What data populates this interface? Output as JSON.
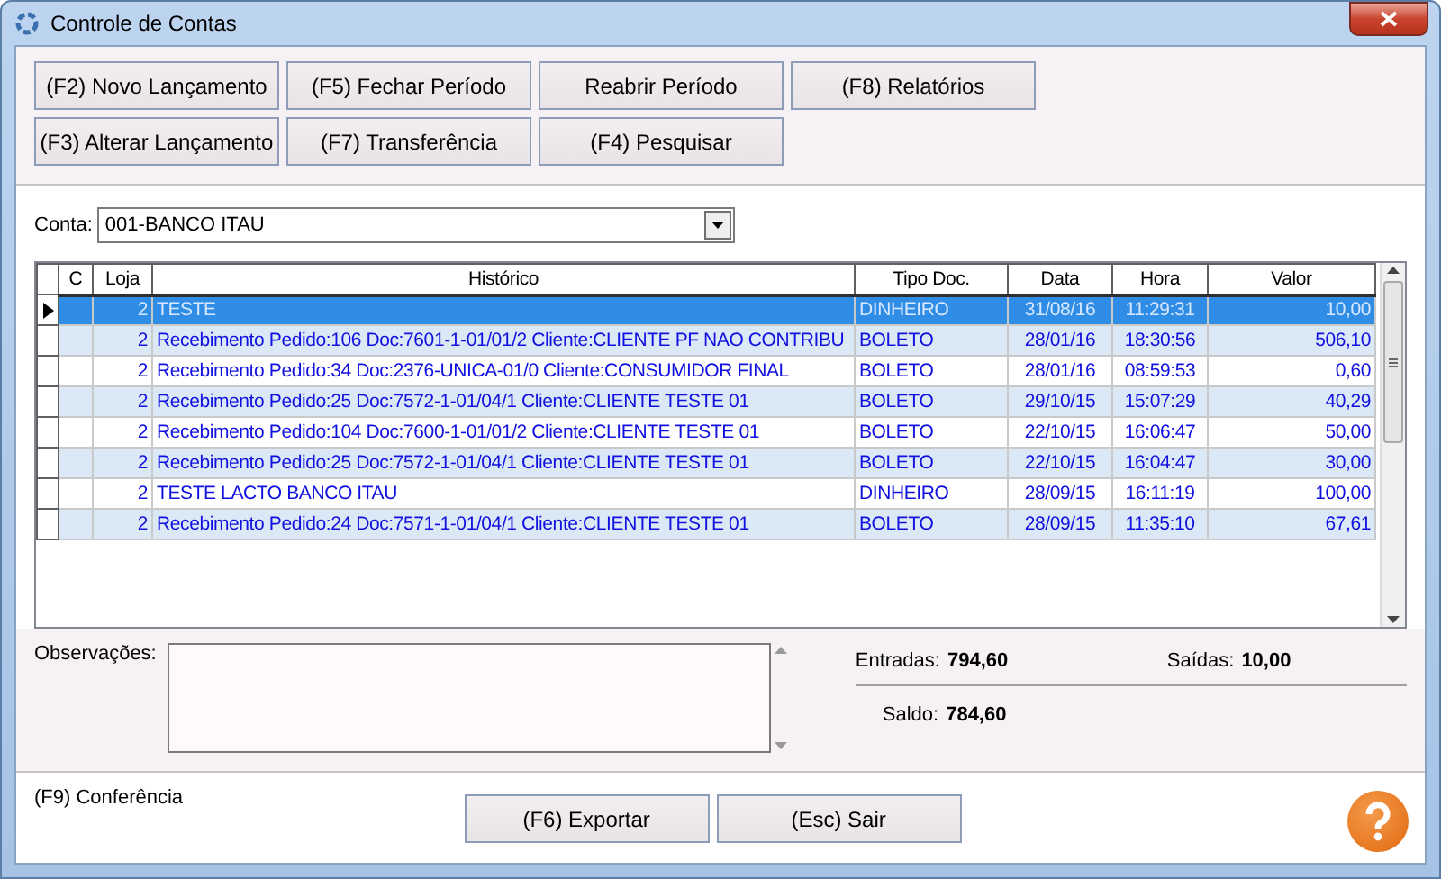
{
  "window": {
    "title": "Controle de Contas"
  },
  "toolbar": [
    [
      "(F2) Novo Lançamento",
      "(F5) Fechar Período",
      "Reabrir Período",
      "(F8) Relatórios"
    ],
    [
      "(F3) Alterar Lançamento",
      "(F7) Transferência",
      "(F4) Pesquisar"
    ]
  ],
  "account": {
    "label": "Conta:",
    "value": "001-BANCO ITAU"
  },
  "table": {
    "columns": [
      "C",
      "Loja",
      "Histórico",
      "Tipo Doc.",
      "Data",
      "Hora",
      "Valor"
    ],
    "rows": [
      {
        "selected": true,
        "cells": [
          "",
          "2",
          "TESTE",
          "DINHEIRO",
          "31/08/16",
          "11:29:31",
          "10,00"
        ]
      },
      {
        "selected": false,
        "cells": [
          "",
          "2",
          "Recebimento Pedido:106 Doc:7601-1-01/01/2 Cliente:CLIENTE PF NAO CONTRIBU",
          "BOLETO",
          "28/01/16",
          "18:30:56",
          "506,10"
        ]
      },
      {
        "selected": false,
        "cells": [
          "",
          "2",
          "Recebimento Pedido:34 Doc:2376-UNICA-01/0 Cliente:CONSUMIDOR FINAL",
          "BOLETO",
          "28/01/16",
          "08:59:53",
          "0,60"
        ]
      },
      {
        "selected": false,
        "cells": [
          "",
          "2",
          "Recebimento Pedido:25 Doc:7572-1-01/04/1 Cliente:CLIENTE TESTE 01",
          "BOLETO",
          "29/10/15",
          "15:07:29",
          "40,29"
        ]
      },
      {
        "selected": false,
        "cells": [
          "",
          "2",
          "Recebimento Pedido:104 Doc:7600-1-01/01/2 Cliente:CLIENTE TESTE 01",
          "BOLETO",
          "22/10/15",
          "16:06:47",
          "50,00"
        ]
      },
      {
        "selected": false,
        "cells": [
          "",
          "2",
          "Recebimento Pedido:25 Doc:7572-1-01/04/1 Cliente:CLIENTE TESTE 01",
          "BOLETO",
          "22/10/15",
          "16:04:47",
          "30,00"
        ]
      },
      {
        "selected": false,
        "cells": [
          "",
          "2",
          "TESTE LACTO BANCO ITAU",
          "DINHEIRO",
          "28/09/15",
          "16:11:19",
          "100,00"
        ]
      },
      {
        "selected": false,
        "cells": [
          "",
          "2",
          "Recebimento Pedido:24 Doc:7571-1-01/04/1 Cliente:CLIENTE TESTE 01",
          "BOLETO",
          "28/09/15",
          "11:35:10",
          "67,61"
        ]
      }
    ]
  },
  "notes": {
    "label": "Observações:"
  },
  "totals": {
    "entradas_label": "Entradas:",
    "entradas": "794,60",
    "saidas_label": "Saídas:",
    "saidas": "10,00",
    "saldo_label": "Saldo:",
    "saldo": "784,60"
  },
  "footer": {
    "hint": "(F9) Conferência",
    "buttons": [
      "(F6) Exportar",
      "(Esc) Sair"
    ]
  }
}
